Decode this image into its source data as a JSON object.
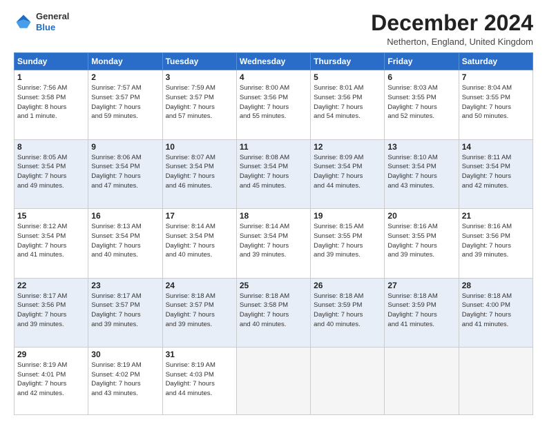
{
  "logo": {
    "line1": "General",
    "line2": "Blue"
  },
  "title": "December 2024",
  "subtitle": "Netherton, England, United Kingdom",
  "days_of_week": [
    "Sunday",
    "Monday",
    "Tuesday",
    "Wednesday",
    "Thursday",
    "Friday",
    "Saturday"
  ],
  "weeks": [
    [
      {
        "day": "1",
        "info": "Sunrise: 7:56 AM\nSunset: 3:58 PM\nDaylight: 8 hours\nand 1 minute."
      },
      {
        "day": "2",
        "info": "Sunrise: 7:57 AM\nSunset: 3:57 PM\nDaylight: 7 hours\nand 59 minutes."
      },
      {
        "day": "3",
        "info": "Sunrise: 7:59 AM\nSunset: 3:57 PM\nDaylight: 7 hours\nand 57 minutes."
      },
      {
        "day": "4",
        "info": "Sunrise: 8:00 AM\nSunset: 3:56 PM\nDaylight: 7 hours\nand 55 minutes."
      },
      {
        "day": "5",
        "info": "Sunrise: 8:01 AM\nSunset: 3:56 PM\nDaylight: 7 hours\nand 54 minutes."
      },
      {
        "day": "6",
        "info": "Sunrise: 8:03 AM\nSunset: 3:55 PM\nDaylight: 7 hours\nand 52 minutes."
      },
      {
        "day": "7",
        "info": "Sunrise: 8:04 AM\nSunset: 3:55 PM\nDaylight: 7 hours\nand 50 minutes."
      }
    ],
    [
      {
        "day": "8",
        "info": "Sunrise: 8:05 AM\nSunset: 3:54 PM\nDaylight: 7 hours\nand 49 minutes."
      },
      {
        "day": "9",
        "info": "Sunrise: 8:06 AM\nSunset: 3:54 PM\nDaylight: 7 hours\nand 47 minutes."
      },
      {
        "day": "10",
        "info": "Sunrise: 8:07 AM\nSunset: 3:54 PM\nDaylight: 7 hours\nand 46 minutes."
      },
      {
        "day": "11",
        "info": "Sunrise: 8:08 AM\nSunset: 3:54 PM\nDaylight: 7 hours\nand 45 minutes."
      },
      {
        "day": "12",
        "info": "Sunrise: 8:09 AM\nSunset: 3:54 PM\nDaylight: 7 hours\nand 44 minutes."
      },
      {
        "day": "13",
        "info": "Sunrise: 8:10 AM\nSunset: 3:54 PM\nDaylight: 7 hours\nand 43 minutes."
      },
      {
        "day": "14",
        "info": "Sunrise: 8:11 AM\nSunset: 3:54 PM\nDaylight: 7 hours\nand 42 minutes."
      }
    ],
    [
      {
        "day": "15",
        "info": "Sunrise: 8:12 AM\nSunset: 3:54 PM\nDaylight: 7 hours\nand 41 minutes."
      },
      {
        "day": "16",
        "info": "Sunrise: 8:13 AM\nSunset: 3:54 PM\nDaylight: 7 hours\nand 40 minutes."
      },
      {
        "day": "17",
        "info": "Sunrise: 8:14 AM\nSunset: 3:54 PM\nDaylight: 7 hours\nand 40 minutes."
      },
      {
        "day": "18",
        "info": "Sunrise: 8:14 AM\nSunset: 3:54 PM\nDaylight: 7 hours\nand 39 minutes."
      },
      {
        "day": "19",
        "info": "Sunrise: 8:15 AM\nSunset: 3:55 PM\nDaylight: 7 hours\nand 39 minutes."
      },
      {
        "day": "20",
        "info": "Sunrise: 8:16 AM\nSunset: 3:55 PM\nDaylight: 7 hours\nand 39 minutes."
      },
      {
        "day": "21",
        "info": "Sunrise: 8:16 AM\nSunset: 3:56 PM\nDaylight: 7 hours\nand 39 minutes."
      }
    ],
    [
      {
        "day": "22",
        "info": "Sunrise: 8:17 AM\nSunset: 3:56 PM\nDaylight: 7 hours\nand 39 minutes."
      },
      {
        "day": "23",
        "info": "Sunrise: 8:17 AM\nSunset: 3:57 PM\nDaylight: 7 hours\nand 39 minutes."
      },
      {
        "day": "24",
        "info": "Sunrise: 8:18 AM\nSunset: 3:57 PM\nDaylight: 7 hours\nand 39 minutes."
      },
      {
        "day": "25",
        "info": "Sunrise: 8:18 AM\nSunset: 3:58 PM\nDaylight: 7 hours\nand 40 minutes."
      },
      {
        "day": "26",
        "info": "Sunrise: 8:18 AM\nSunset: 3:59 PM\nDaylight: 7 hours\nand 40 minutes."
      },
      {
        "day": "27",
        "info": "Sunrise: 8:18 AM\nSunset: 3:59 PM\nDaylight: 7 hours\nand 41 minutes."
      },
      {
        "day": "28",
        "info": "Sunrise: 8:18 AM\nSunset: 4:00 PM\nDaylight: 7 hours\nand 41 minutes."
      }
    ],
    [
      {
        "day": "29",
        "info": "Sunrise: 8:19 AM\nSunset: 4:01 PM\nDaylight: 7 hours\nand 42 minutes."
      },
      {
        "day": "30",
        "info": "Sunrise: 8:19 AM\nSunset: 4:02 PM\nDaylight: 7 hours\nand 43 minutes."
      },
      {
        "day": "31",
        "info": "Sunrise: 8:19 AM\nSunset: 4:03 PM\nDaylight: 7 hours\nand 44 minutes."
      },
      {
        "day": "",
        "info": ""
      },
      {
        "day": "",
        "info": ""
      },
      {
        "day": "",
        "info": ""
      },
      {
        "day": "",
        "info": ""
      }
    ]
  ]
}
